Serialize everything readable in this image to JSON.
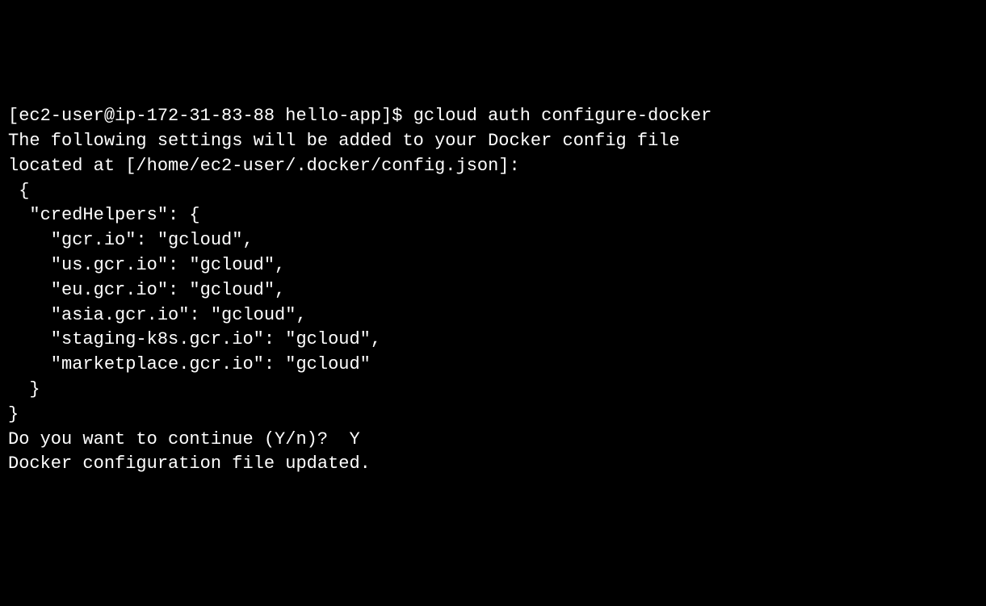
{
  "terminal": {
    "prompt": "[ec2-user@ip-172-31-83-88 hello-app]$ ",
    "command": "gcloud auth configure-docker",
    "output_line1": "The following settings will be added to your Docker config file",
    "output_line2": "located at [/home/ec2-user/.docker/config.json]:",
    "json_line1": " {",
    "json_line2": "  \"credHelpers\": {",
    "json_line3": "    \"gcr.io\": \"gcloud\",",
    "json_line4": "    \"us.gcr.io\": \"gcloud\",",
    "json_line5": "    \"eu.gcr.io\": \"gcloud\",",
    "json_line6": "    \"asia.gcr.io\": \"gcloud\",",
    "json_line7": "    \"staging-k8s.gcr.io\": \"gcloud\",",
    "json_line8": "    \"marketplace.gcr.io\": \"gcloud\"",
    "json_line9": "  }",
    "json_line10": "}",
    "blank_line": "",
    "confirm_prompt": "Do you want to continue (Y/n)?  ",
    "confirm_response": "Y",
    "blank_line2": "",
    "success_msg": "Docker configuration file updated."
  }
}
